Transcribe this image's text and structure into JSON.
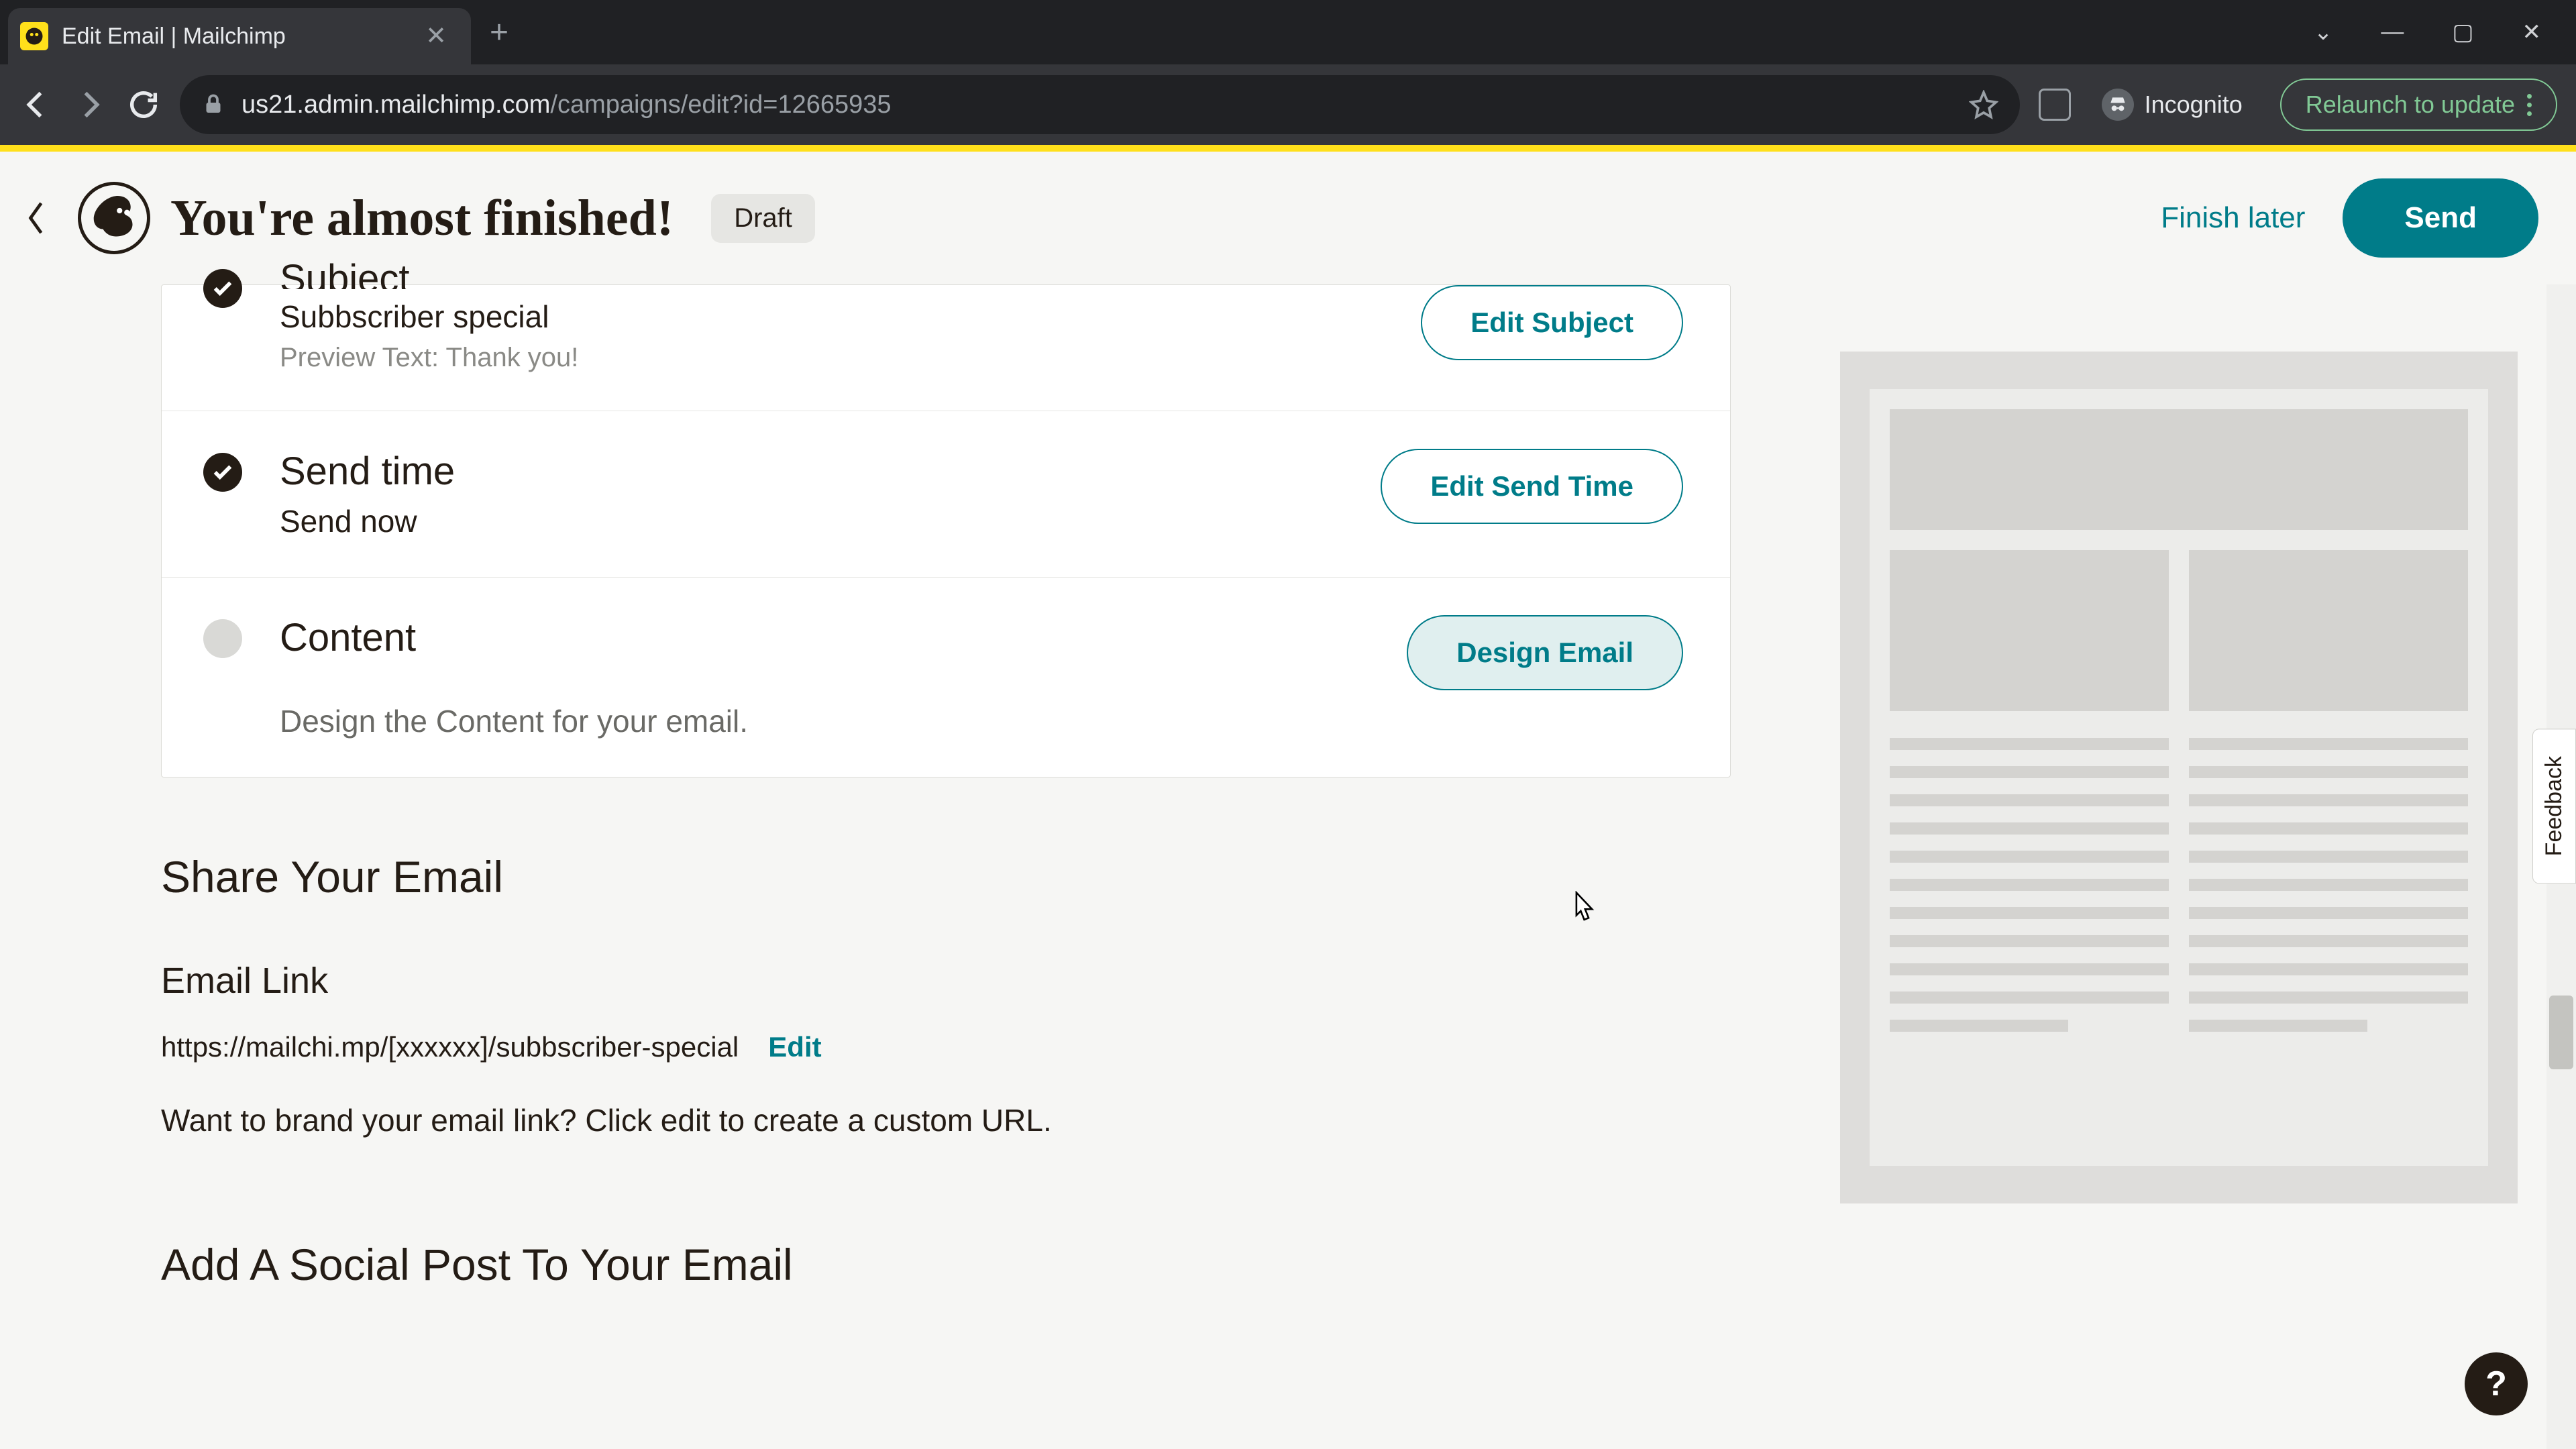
{
  "browser": {
    "tab_title": "Edit Email | Mailchimp",
    "url_host": "us21.admin.mailchimp.com",
    "url_path": "/campaigns/edit?id=12665935",
    "incognito_label": "Incognito",
    "relaunch_label": "Relaunch to update"
  },
  "header": {
    "title": "You're almost finished!",
    "status_badge": "Draft",
    "finish_later": "Finish later",
    "send": "Send"
  },
  "checklist": {
    "subject": {
      "title": "Subject",
      "value": "Subbscriber special",
      "preview_text": "Preview Text: Thank you!",
      "action": "Edit Subject"
    },
    "send_time": {
      "title": "Send time",
      "value": "Send now",
      "action": "Edit Send Time"
    },
    "content": {
      "title": "Content",
      "description": "Design the Content for your email.",
      "action": "Design Email"
    }
  },
  "share": {
    "heading": "Share Your Email",
    "link_heading": "Email Link",
    "link_url": "https://mailchi.mp/[xxxxxx]/subbscriber-special",
    "edit_label": "Edit",
    "hint": "Want to brand your email link? Click edit to create a custom URL.",
    "social_heading": "Add A Social Post To Your Email"
  },
  "widgets": {
    "feedback": "Feedback",
    "help": "?"
  }
}
